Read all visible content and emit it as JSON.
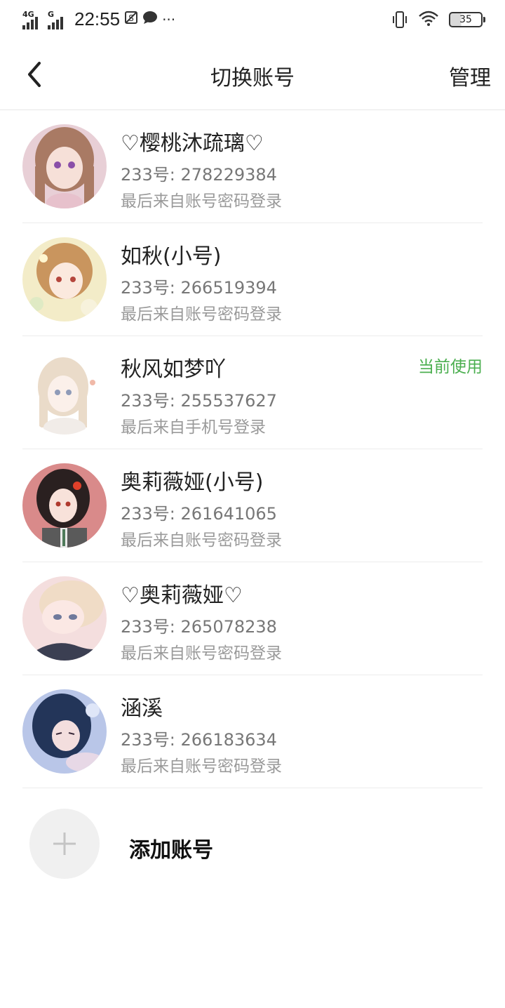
{
  "status_bar": {
    "network1": "4G",
    "network2": "G",
    "time": "22:55",
    "battery": "35",
    "icons": [
      "sim-off-icon",
      "chat-bubble-icon",
      "more-dots-icon",
      "vibrate-icon",
      "wifi-icon",
      "battery-icon"
    ],
    "more": "···"
  },
  "header": {
    "title": "切换账号",
    "manage_label": "管理",
    "back_icon": "chevron-left-icon"
  },
  "accounts": [
    {
      "name": "♡樱桃沐疏璃♡",
      "id": "233号: 278229384",
      "login": "最后来自账号密码登录",
      "current": ""
    },
    {
      "name": "如秋(小号)",
      "id": "233号: 266519394",
      "login": "最后来自账号密码登录",
      "current": ""
    },
    {
      "name": "秋风如梦吖",
      "id": "233号: 255537627",
      "login": "最后来自手机号登录",
      "current": "当前使用"
    },
    {
      "name": "奥莉薇娅(小号)",
      "id": "233号: 261641065",
      "login": "最后来自账号密码登录",
      "current": ""
    },
    {
      "name": "♡奥莉薇娅♡",
      "id": "233号: 265078238",
      "login": "最后来自账号密码登录",
      "current": ""
    },
    {
      "name": "涵溪",
      "id": "233号: 266183634",
      "login": "最后来自账号密码登录",
      "current": ""
    }
  ],
  "add_account": {
    "label": "添加账号",
    "icon": "plus-icon"
  },
  "colors": {
    "accent_green": "#4caf50",
    "divider": "#ececec",
    "secondary_text": "#777777"
  }
}
